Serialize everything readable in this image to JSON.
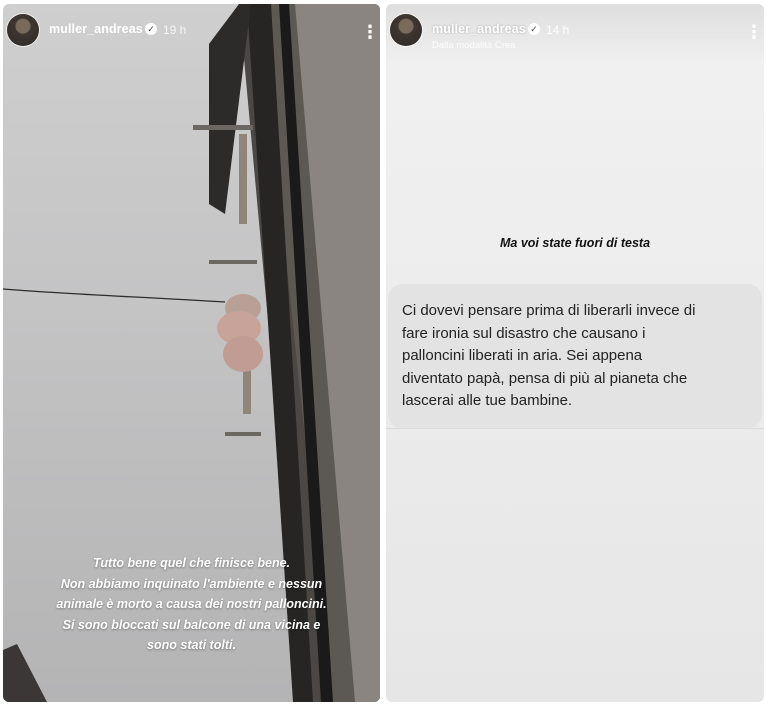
{
  "left_story": {
    "username": "muller_andreas",
    "timestamp": "19 h",
    "caption_lines": [
      "Tutto bene quel che finisce bene.",
      "Non abbiamo inquinato l'ambiente e nessun",
      "animale è morto a causa dei nostri palloncini.",
      "Si sono bloccati sul balcone di una vicina e",
      "sono stati tolti."
    ]
  },
  "right_story": {
    "username": "muller_andreas",
    "timestamp": "14 h",
    "subtitle": "Dalla modalità Crea",
    "headline": "Ma voi state fuori di testa",
    "message_lines": [
      "Ci dovevi pensare prima di liberarli invece di",
      "fare ironia sul disastro che causano i",
      "palloncini liberati in aria. Sei appena",
      "diventato papà, pensa di più al pianeta che",
      "lascerai alle tue bambine."
    ]
  },
  "icons": {
    "verified": "verified-badge-icon",
    "more": "more-options-icon"
  },
  "colors": {
    "sky": "#c6c6c7",
    "wall": "#3a3836",
    "bubble": "#e3e3e3",
    "balloon": "#c7a39a"
  }
}
